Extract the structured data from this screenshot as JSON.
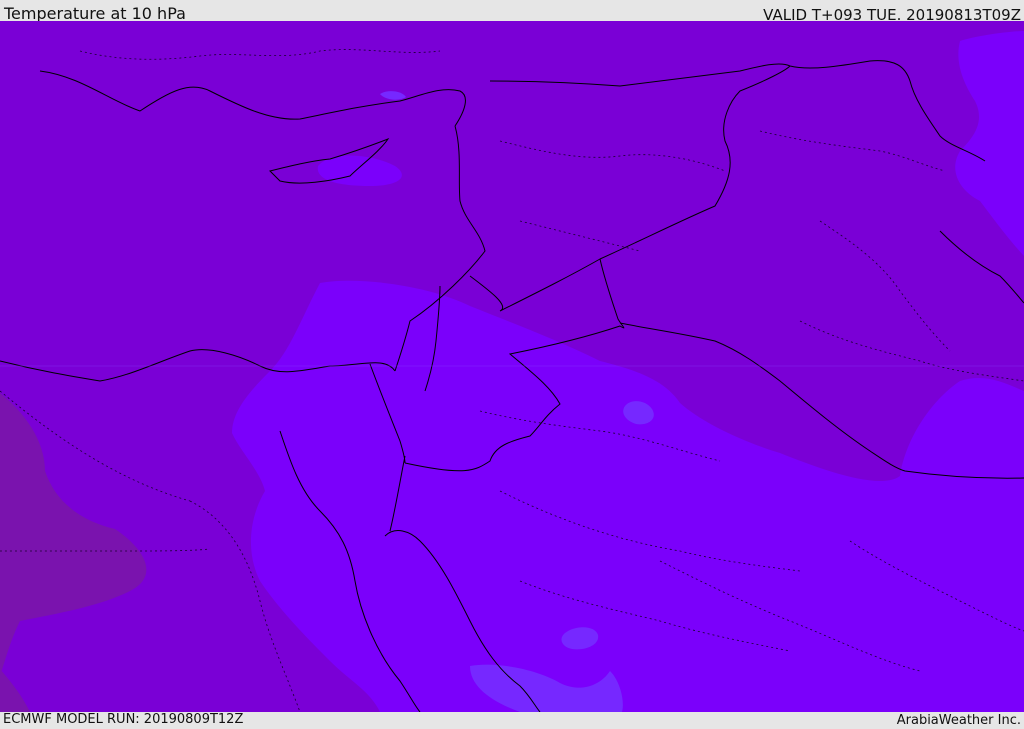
{
  "header": {
    "title": "Temperature at 10 hPa",
    "valid_time": "VALID T+093 TUE. 20190813T09Z"
  },
  "footer": {
    "model_run": "ECMWF MODEL RUN: 20190809T12Z",
    "credit": "ArabiaWeather Inc."
  },
  "map": {
    "colors": {
      "warmest_band": "#7a13ae",
      "mid_band": "#7a00d6",
      "cool_band": "#7b00fb",
      "coolest_band": "#7628ff",
      "boundary_line": "#000000"
    }
  }
}
